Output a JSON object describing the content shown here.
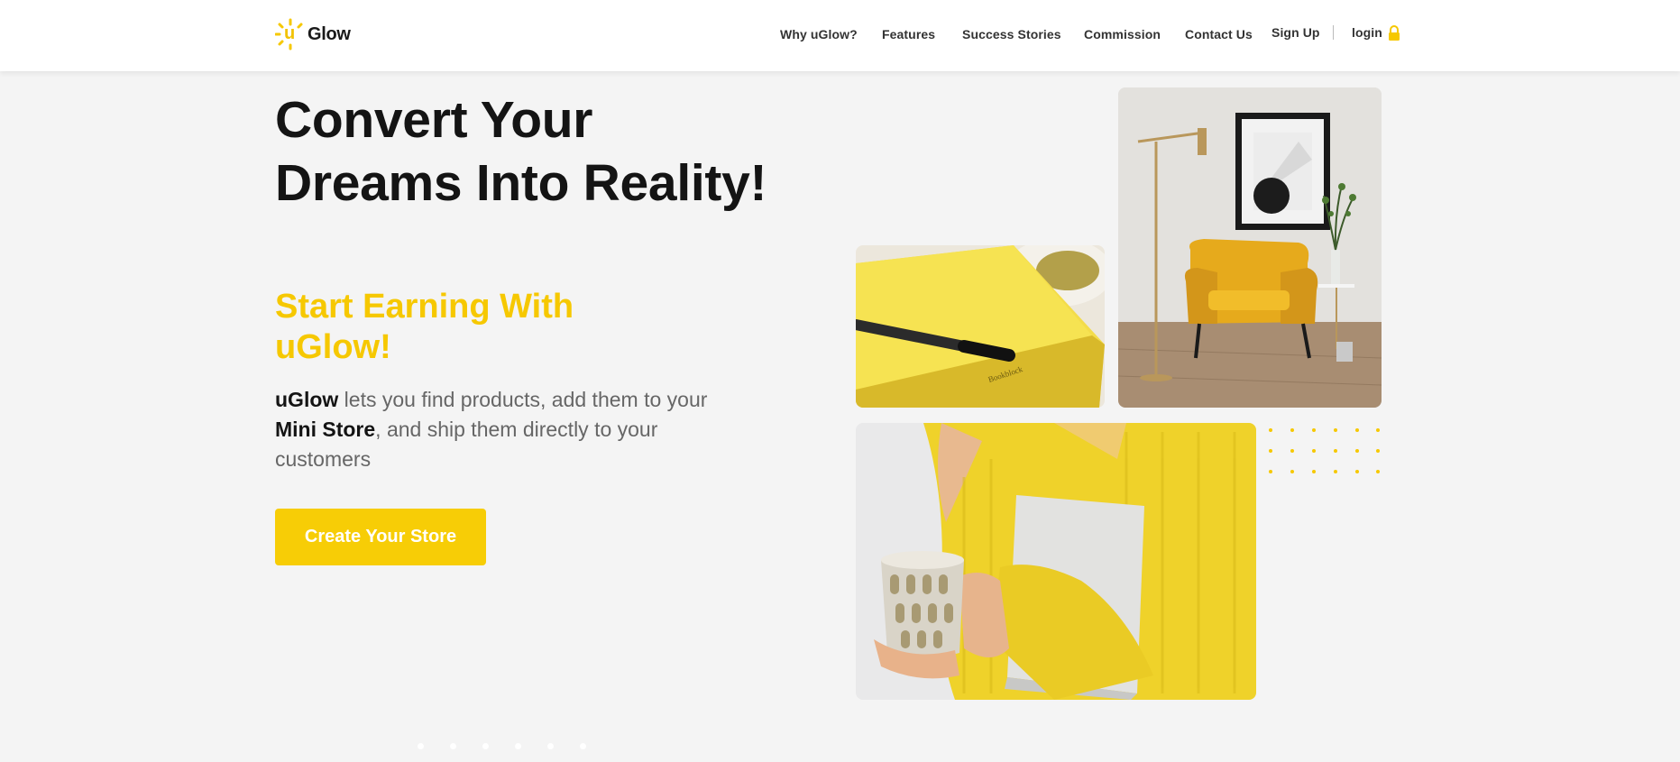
{
  "brand": {
    "logo_u": "u",
    "logo_text": "Glow",
    "accent": "#f7cd06"
  },
  "nav": {
    "why": "Why uGlow?",
    "features": "Features",
    "stories": "Success Stories",
    "commission": "Commission",
    "contact": "Contact Us",
    "signup": "Sign Up",
    "login": "login"
  },
  "hero": {
    "title_line1": "Convert Your",
    "title_line2": "Dreams Into Reality!",
    "subtitle": "Start Earning With uGlow!",
    "desc_brand": "uGlow",
    "desc_part1": " lets you find products, add them to your ",
    "desc_store": "Mini Store",
    "desc_part2": ", and ship them directly to your customers",
    "cta": "Create Your Store"
  },
  "images": {
    "notebook_brand": "Bookblock"
  }
}
